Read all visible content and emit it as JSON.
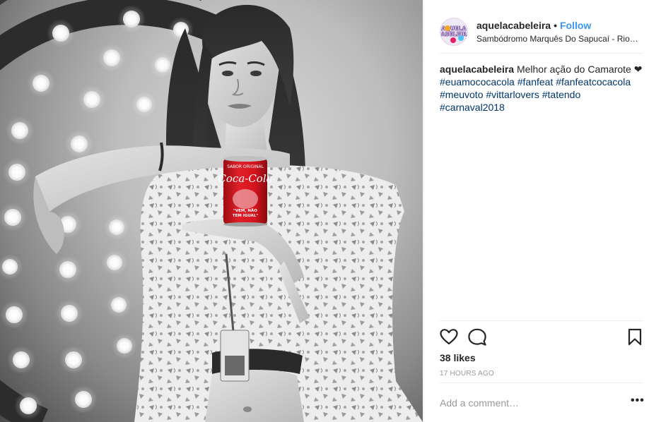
{
  "post": {
    "username": "aquelacabeleira",
    "separator": "•",
    "follow_label": "Follow",
    "location": "Sambódromo Marquês Do Sapucaí - Rio de Janeiro",
    "avatar_text": "AQUELA CABELEIRA",
    "caption": {
      "username": "aquelacabeleira",
      "text": "Melhor ação do Camarote",
      "heart": "❤",
      "hashtags": [
        "#euamococacola",
        "#fanfeat",
        "#fanfeatcocacola",
        "#meuvoto",
        "#vittarlovers",
        "#tatendo",
        "#carnaval2018"
      ]
    },
    "likes": "38 likes",
    "timestamp": "17 HOURS AGO",
    "comment_placeholder": "Add a comment…",
    "more_label": "•••"
  },
  "photo": {
    "can_brand": "Coca-Cola",
    "can_top_text": "SABOR ORIGINAL",
    "can_quote_line1": "\"VEM, NÃO",
    "can_quote_line2": "TEM IGUAL\""
  },
  "colors": {
    "accent": "#3897f0",
    "hashtag": "#003569",
    "can_red": "#d7141e",
    "border": "#efefef"
  },
  "icons": {
    "like": "heart-icon",
    "comment": "comment-icon",
    "save": "bookmark-icon",
    "more": "more-options-icon"
  }
}
